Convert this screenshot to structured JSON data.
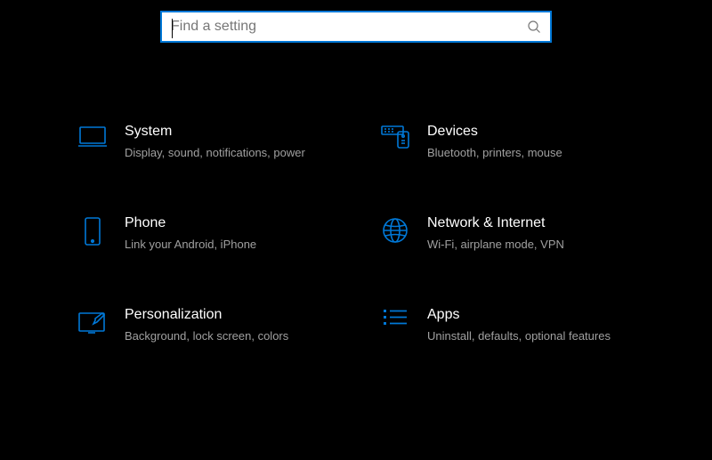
{
  "search": {
    "placeholder": "Find a setting"
  },
  "categories": {
    "system": {
      "title": "System",
      "desc": "Display, sound, notifications, power"
    },
    "devices": {
      "title": "Devices",
      "desc": "Bluetooth, printers, mouse"
    },
    "phone": {
      "title": "Phone",
      "desc": "Link your Android, iPhone"
    },
    "network": {
      "title": "Network & Internet",
      "desc": "Wi-Fi, airplane mode, VPN"
    },
    "personalization": {
      "title": "Personalization",
      "desc": "Background, lock screen, colors"
    },
    "apps": {
      "title": "Apps",
      "desc": "Uninstall, defaults, optional features"
    }
  }
}
